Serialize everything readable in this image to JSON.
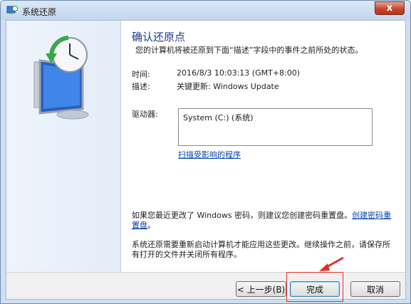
{
  "window": {
    "title": "系统还原",
    "close_label": "x"
  },
  "page": {
    "heading": "确认还原点",
    "subtitle": "您的计算机将被还原到下面“描述”字段中的事件之前所处的状态。"
  },
  "details": {
    "time_label": "时间:",
    "time_value": "2016/8/3 10:03:13 (GMT+8:00)",
    "desc_label": "描述:",
    "desc_value": "关键更新: Windows Update",
    "driver_label": "驱动器:",
    "driver_value": "System (C:) (系统)",
    "scan_link": "扫描受影响的程序"
  },
  "notes": {
    "password_text": "如果您最近更改了 Windows 密码，则建议您创建密码重置盘。",
    "password_link": "创建密码重置盘",
    "password_end": "。",
    "restart_text": "系统还原需要重新启动计算机才能应用这些更改。继续操作之前，请保存所有打开的文件并关闭所有程序。"
  },
  "buttons": {
    "back": "< 上一步(B)",
    "finish": "完成",
    "cancel": "取消"
  },
  "colors": {
    "accent": "#1e3a8a",
    "link": "#0645ad",
    "highlight": "#e0302a"
  }
}
